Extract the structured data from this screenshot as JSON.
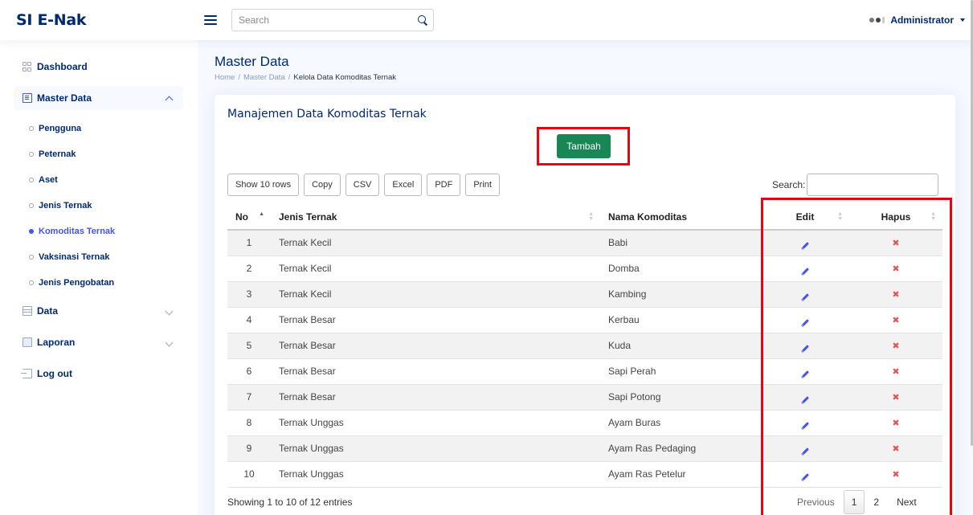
{
  "header": {
    "brand": "SI E-Nak",
    "search_placeholder": "Search",
    "user_name": "Administrator"
  },
  "sidebar": {
    "items": [
      {
        "label": "Dashboard",
        "icon": "grid-icon"
      },
      {
        "label": "Master Data",
        "icon": "journal-icon",
        "expanded": true
      },
      {
        "label": "Data",
        "icon": "data-icon"
      },
      {
        "label": "Laporan",
        "icon": "report-icon"
      },
      {
        "label": "Log out",
        "icon": "logout-icon"
      }
    ],
    "sub_items": [
      "Pengguna",
      "Peternak",
      "Aset",
      "Jenis Ternak",
      "Komoditas Ternak",
      "Vaksinasi Ternak",
      "Jenis Pengobatan"
    ],
    "active_sub": "Komoditas Ternak"
  },
  "page": {
    "title": "Master Data",
    "breadcrumb": [
      "Home",
      "Master Data",
      "Kelola Data Komoditas Ternak"
    ],
    "separator": "/"
  },
  "card": {
    "title": "Manajemen Data Komoditas Ternak",
    "add_button": "Tambah",
    "export_buttons": [
      "Show 10 rows",
      "Copy",
      "CSV",
      "Excel",
      "PDF",
      "Print"
    ],
    "search_label": "Search:",
    "search_value": ""
  },
  "table": {
    "headers": {
      "no": "No",
      "jenis": "Jenis Ternak",
      "nama": "Nama Komoditas",
      "edit": "Edit",
      "hapus": "Hapus"
    },
    "rows": [
      {
        "no": "1",
        "jenis": "Ternak Kecil",
        "nama": "Babi"
      },
      {
        "no": "2",
        "jenis": "Ternak Kecil",
        "nama": "Domba"
      },
      {
        "no": "3",
        "jenis": "Ternak Kecil",
        "nama": "Kambing"
      },
      {
        "no": "4",
        "jenis": "Ternak Besar",
        "nama": "Kerbau"
      },
      {
        "no": "5",
        "jenis": "Ternak Besar",
        "nama": "Kuda"
      },
      {
        "no": "6",
        "jenis": "Ternak Besar",
        "nama": "Sapi Perah"
      },
      {
        "no": "7",
        "jenis": "Ternak Besar",
        "nama": "Sapi Potong"
      },
      {
        "no": "8",
        "jenis": "Ternak Unggas",
        "nama": "Ayam Buras"
      },
      {
        "no": "9",
        "jenis": "Ternak Unggas",
        "nama": "Ayam Ras Pedaging"
      },
      {
        "no": "10",
        "jenis": "Ternak Unggas",
        "nama": "Ayam Ras Petelur"
      }
    ],
    "edit_icon": "pencil-icon",
    "delete_icon": "x-icon"
  },
  "footer": {
    "showing": "Showing 1 to 10 of 12 entries",
    "prev": "Previous",
    "pages": [
      "1",
      "2"
    ],
    "current_page": "1",
    "next": "Next"
  },
  "colors": {
    "primary": "#012970",
    "accent": "#4154f1",
    "add_button": "#198754",
    "highlight": "#e30613",
    "delete": "#e25555"
  }
}
